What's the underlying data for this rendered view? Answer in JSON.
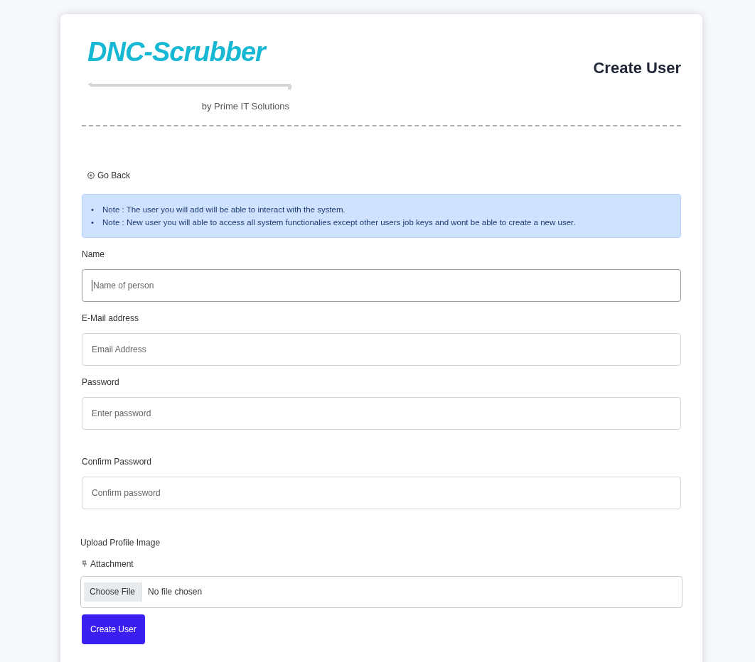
{
  "logo": {
    "name": "DNC-Scrubber",
    "byline": "by Prime IT Solutions"
  },
  "heading": "Create User",
  "back_link": "Go Back",
  "notes": [
    {
      "marker": "•",
      "text": "Note : The user you will add will be able to interact with the system."
    },
    {
      "marker": "•",
      "text": "Note : New user you will able to access all system functionalies except other users job keys and wont be able to create a new user."
    }
  ],
  "fields": [
    {
      "label": "Name",
      "placeholder": "Name of person",
      "focused": true
    },
    {
      "label": "E-Mail address",
      "placeholder": "Email Address",
      "focused": false
    },
    {
      "label": "Password",
      "placeholder": "Enter password",
      "focused": false
    },
    {
      "label": "Confirm Password",
      "placeholder": "Confirm password",
      "focused": false
    }
  ],
  "upload": {
    "title": "Upload Profile Image",
    "label": "Attachment",
    "button": "Choose File",
    "status": "No file chosen"
  },
  "submit": "Create User"
}
